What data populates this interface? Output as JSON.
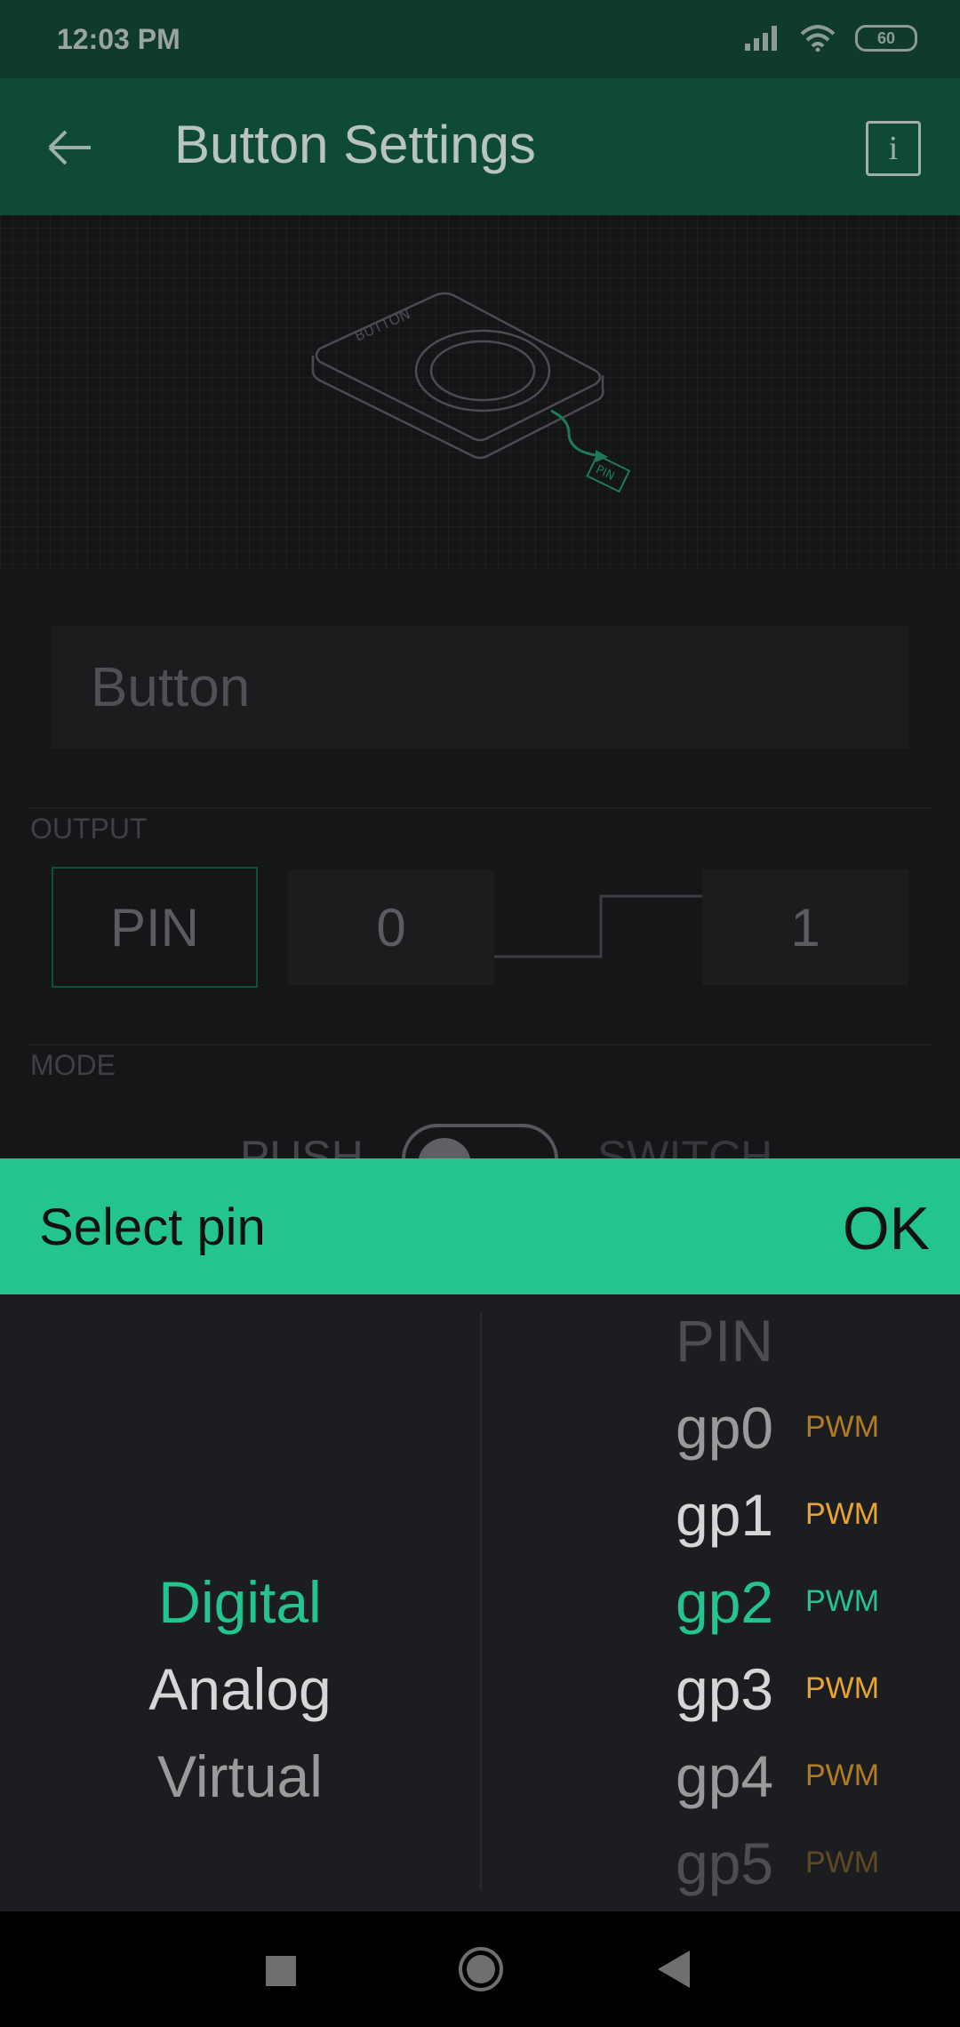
{
  "status_bar": {
    "time": "12:03 PM",
    "battery": "60",
    "icons": [
      "signal-icon",
      "wifi-icon",
      "battery-icon"
    ]
  },
  "app_bar": {
    "title": "Button Settings",
    "back_icon": "arrow-left-icon",
    "info_label": "i"
  },
  "preview": {
    "device_label": "BUTTON",
    "pin_label": "PIN"
  },
  "form": {
    "name_placeholder": "Button",
    "output_label": "OUTPUT",
    "pin_label": "PIN",
    "off_value": "0",
    "on_value": "1",
    "mode_label": "MODE",
    "mode_push": "PUSH",
    "mode_switch": "SWITCH"
  },
  "picker": {
    "title": "Select pin",
    "ok_label": "OK",
    "types": [
      {
        "label": "Digital",
        "selected": true
      },
      {
        "label": "Analog",
        "selected": false
      },
      {
        "label": "Virtual",
        "selected": false
      }
    ],
    "header_pin": "PIN",
    "pins": [
      {
        "label": "gp0",
        "tag": "PWM"
      },
      {
        "label": "gp1",
        "tag": "PWM"
      },
      {
        "label": "gp2",
        "tag": "PWM",
        "selected": true
      },
      {
        "label": "gp3",
        "tag": "PWM"
      },
      {
        "label": "gp4",
        "tag": "PWM"
      },
      {
        "label": "gp5",
        "tag": "PWM"
      }
    ]
  },
  "colors": {
    "accent": "#23c48e",
    "pwm": "#e8a42c",
    "app_bar": "#0f4a35",
    "status_bar": "#0f3a2c"
  },
  "nav_bar": {
    "icons": [
      "recents-icon",
      "home-icon",
      "back-icon"
    ]
  }
}
